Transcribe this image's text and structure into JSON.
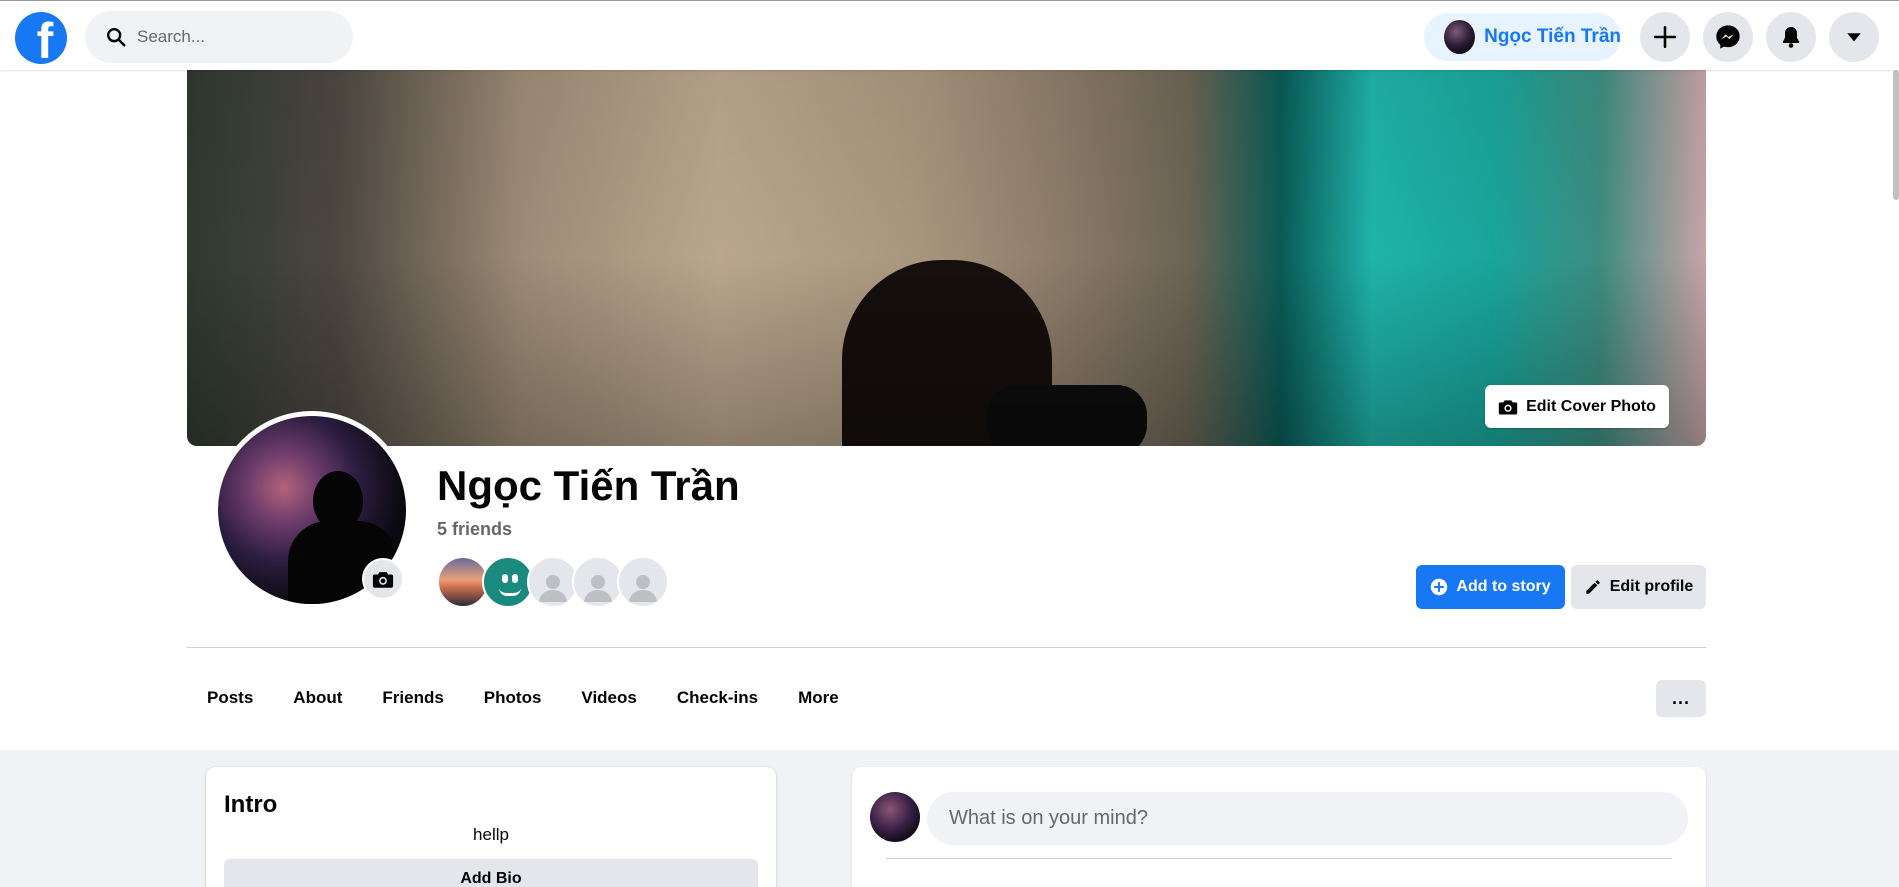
{
  "topbar": {
    "logo_icon": "facebook-logo-icon",
    "search_placeholder": "Search...",
    "user_name": "Ngọc Tiến Trần",
    "buttons": [
      "plus-icon",
      "messenger-icon",
      "bell-icon",
      "caret-down-icon"
    ]
  },
  "profile": {
    "name": "Ngọc Tiến Trần",
    "friends_count": "5 friends",
    "edit_cover_label": "Edit Cover Photo",
    "add_story_label": "Add to story",
    "edit_profile_label": "Edit profile",
    "more_options_label": "..."
  },
  "tabs": [
    "Posts",
    "About",
    "Friends",
    "Photos",
    "Videos",
    "Check-ins",
    "More"
  ],
  "intro": {
    "title": "Intro",
    "bio": "hellp",
    "add_bio_label": "Add Bio"
  },
  "composer": {
    "placeholder": "What is on your mind?"
  },
  "colors": {
    "brand": "#1877f2",
    "chip_bg": "#e7f3ff",
    "button_gray": "#e4e6eb",
    "page_bg": "#f0f2f5"
  }
}
